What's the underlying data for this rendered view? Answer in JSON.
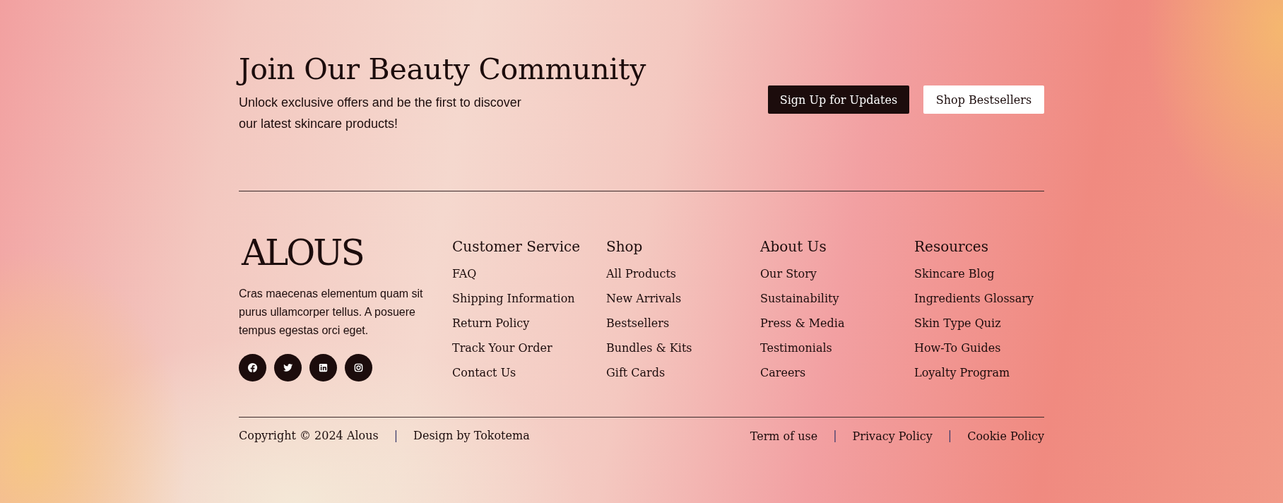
{
  "newsletter": {
    "title": "Join Our Beauty Community",
    "text": "Unlock exclusive offers and be the first to discover our latest skincare products!",
    "buttons": [
      {
        "label": "Sign Up for Updates",
        "kind": "primary"
      },
      {
        "label": "Shop Bestsellers",
        "kind": "secondary"
      }
    ]
  },
  "brand": {
    "logo": "ALOUS",
    "text": "Cras maecenas elementum quam sit purus ullamcorper tellus. A posuere tempus egestas orci eget.",
    "social": [
      {
        "kind": "facebook"
      },
      {
        "kind": "twitter"
      },
      {
        "kind": "linkedin"
      },
      {
        "kind": "instagram"
      }
    ]
  },
  "columns": [
    {
      "title": "Customer Service",
      "links": [
        "FAQ",
        "Shipping Information",
        "Return Policy",
        "Track Your Order",
        "Contact Us"
      ]
    },
    {
      "title": "Shop",
      "links": [
        "All Products",
        "New Arrivals",
        "Bestsellers",
        "Bundles & Kits",
        "Gift Cards"
      ]
    },
    {
      "title": "About Us",
      "links": [
        "Our Story",
        "Sustainability",
        "Press & Media",
        "Testimonials",
        "Careers"
      ]
    },
    {
      "title": "Resources",
      "links": [
        "Skincare Blog",
        "Ingredients Glossary",
        "Skin Type Quiz",
        "How-To Guides",
        "Loyalty Program"
      ]
    }
  ],
  "bottom_bar": {
    "left": [
      {
        "kind": "text",
        "text": "Copyright © 2024 Alous"
      },
      {
        "kind": "separator",
        "text": "|"
      },
      {
        "kind": "text",
        "text": "Design by Tokotema"
      }
    ],
    "right": [
      {
        "kind": "link",
        "text": "Term of use"
      },
      {
        "kind": "separator",
        "text": "|"
      },
      {
        "kind": "link",
        "text": "Privacy Policy"
      },
      {
        "kind": "separator",
        "text": "|"
      },
      {
        "kind": "link",
        "text": "Cookie Policy"
      }
    ]
  }
}
